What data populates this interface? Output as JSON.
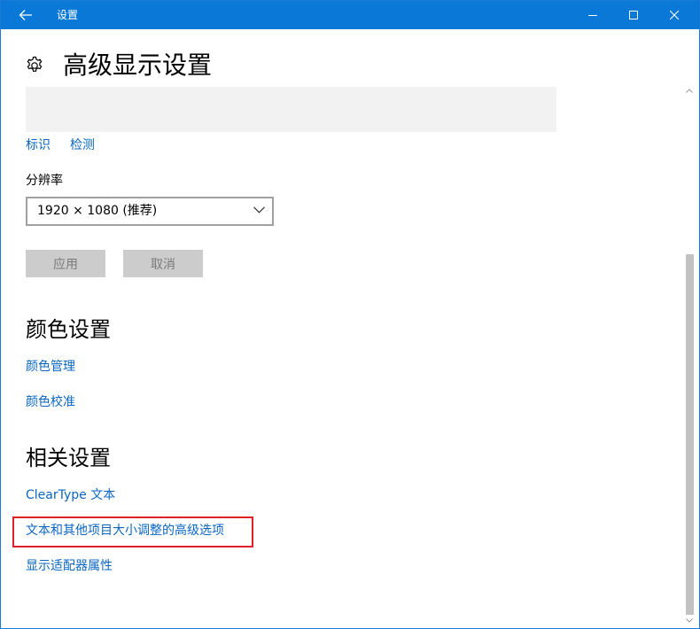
{
  "window": {
    "title": "设置",
    "back_icon": "arrow-left-icon",
    "controls": [
      "minimize-icon",
      "maximize-icon",
      "close-icon"
    ]
  },
  "page": {
    "icon": "gear-icon",
    "title": "高级显示设置"
  },
  "display": {
    "identify_link": "标识",
    "detect_link": "检测"
  },
  "resolution": {
    "label": "分辨率",
    "selected": "1920 × 1080 (推荐)"
  },
  "actions": {
    "apply_label": "应用",
    "cancel_label": "取消",
    "enabled": false
  },
  "color_settings": {
    "heading": "颜色设置",
    "color_management": "颜色管理",
    "color_calibration": "颜色校准"
  },
  "related_settings": {
    "heading": "相关设置",
    "cleartype": "ClearType 文本",
    "advanced_sizing": "文本和其他项目大小调整的高级选项",
    "adapter_properties": "显示适配器属性"
  },
  "colors": {
    "titlebar": "#0a78d7",
    "link": "#0a66c2",
    "highlight": "#e0202a",
    "disabled_button": "#cccccc"
  }
}
